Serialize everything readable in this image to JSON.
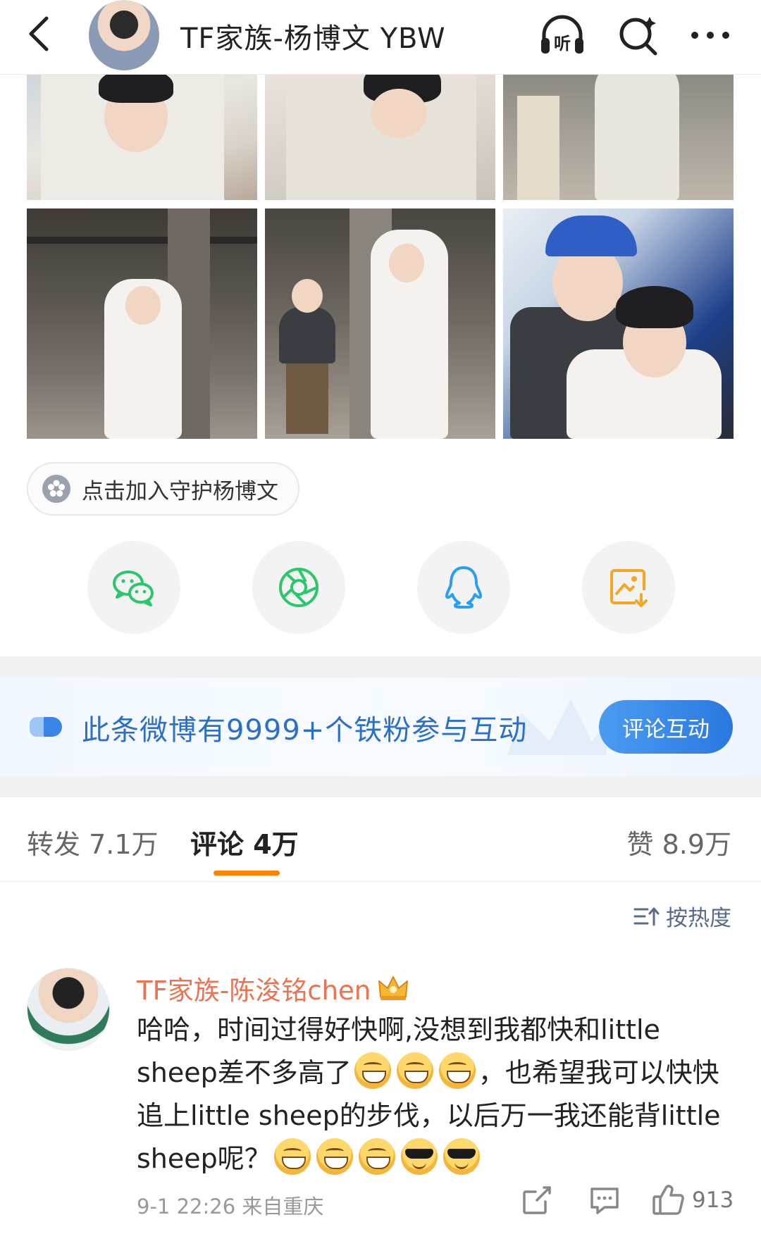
{
  "header": {
    "title": "TF家族-杨博文 YBW",
    "back_icon": "chevron-left-icon",
    "listen_icon": "headphones-icon",
    "search_icon": "search-icon",
    "more_icon": "more-dots-icon"
  },
  "photos": [
    {
      "name": "photo-1"
    },
    {
      "name": "photo-2"
    },
    {
      "name": "photo-3"
    },
    {
      "name": "photo-4"
    },
    {
      "name": "photo-5"
    },
    {
      "name": "photo-6"
    }
  ],
  "join": {
    "label": "点击加入守护杨博文",
    "icon": "flower-icon"
  },
  "share": [
    {
      "icon": "wechat-icon",
      "color": "#2bc76b"
    },
    {
      "icon": "moments-icon",
      "color": "#2bc76b"
    },
    {
      "icon": "qq-icon",
      "color": "#2a9ef0"
    },
    {
      "icon": "save-image-icon",
      "color": "#f5a623"
    }
  ],
  "banner": {
    "text": "此条微博有9999+个铁粉参与互动",
    "button_label": "评论互动"
  },
  "tabs": {
    "repost": "转发 7.1万",
    "comment": "评论 4万",
    "like": "赞 8.9万"
  },
  "sort": {
    "label": "按热度"
  },
  "comment": {
    "author": "TF家族-陈浚铭chen",
    "text_1": "哈哈，时间过得好快啊,没想到我都快和little sheep差不多高了",
    "text_2": "，也希望我可以快快追上little sheep的步伐，以后万一我还能背little sheep呢？",
    "meta": "9-1 22:26  来自重庆",
    "like_count": "913"
  },
  "colors": {
    "accent": "#ff8200",
    "author": "#eb7350",
    "banner_text": "#2c6fc9",
    "banner_button": "#2a78e0"
  }
}
